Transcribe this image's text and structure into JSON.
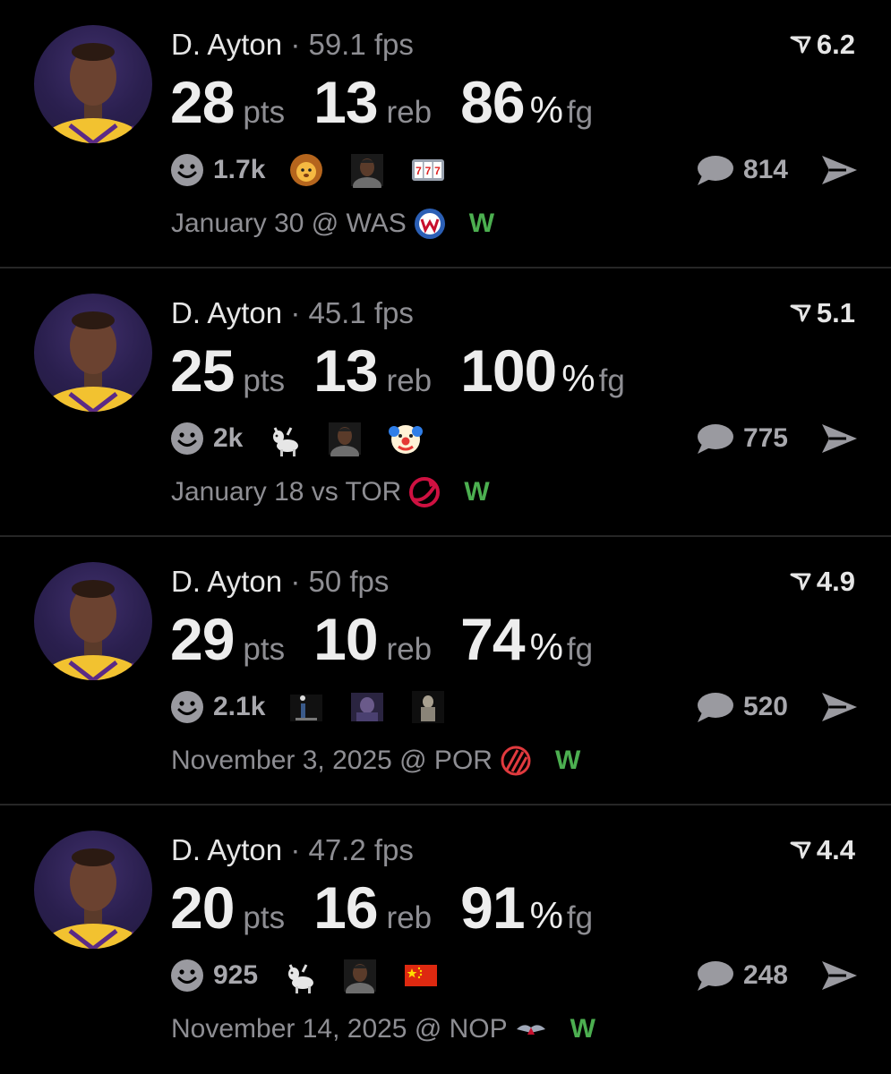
{
  "colors": {
    "background": "#000000",
    "win": "#4caf50",
    "muted": "#8e8e93",
    "text": "#ededed"
  },
  "posts": [
    {
      "player": "D. Ayton",
      "fps_text": "· 59.1 fps",
      "score": "6.2",
      "pts": "28",
      "pts_label": "pts",
      "reb": "13",
      "reb_label": "reb",
      "fg": "86",
      "fg_pct": "%",
      "fg_label": "fg",
      "reaction_count": "1.7k",
      "reaction_icons": [
        "lion-emoji-icon",
        "person-reaction-icon",
        "slot-777-icon"
      ],
      "comment_count": "814",
      "date_text": "January 30 @ WAS",
      "team_logo": "wizards-logo-icon",
      "result": "W"
    },
    {
      "player": "D. Ayton",
      "fps_text": "· 45.1 fps",
      "score": "5.1",
      "pts": "25",
      "pts_label": "pts",
      "reb": "13",
      "reb_label": "reb",
      "fg": "100",
      "fg_pct": "%",
      "fg_label": "fg",
      "reaction_count": "2k",
      "reaction_icons": [
        "goat-emoji-icon",
        "person-reaction-icon",
        "clown-emoji-icon"
      ],
      "comment_count": "775",
      "date_text": "January 18 vs TOR",
      "team_logo": "raptors-logo-icon",
      "result": "W"
    },
    {
      "player": "D. Ayton",
      "fps_text": "· 50 fps",
      "score": "4.9",
      "pts": "29",
      "pts_label": "pts",
      "reb": "10",
      "reb_label": "reb",
      "fg": "74",
      "fg_pct": "%",
      "fg_label": "fg",
      "reaction_count": "2.1k",
      "reaction_icons": [
        "photo-reaction-icon",
        "photo-reaction-icon",
        "photo-reaction-icon"
      ],
      "comment_count": "520",
      "date_text": "November 3, 2025 @ POR",
      "team_logo": "blazers-logo-icon",
      "result": "W"
    },
    {
      "player": "D. Ayton",
      "fps_text": "· 47.2 fps",
      "score": "4.4",
      "pts": "20",
      "pts_label": "pts",
      "reb": "16",
      "reb_label": "reb",
      "fg": "91",
      "fg_pct": "%",
      "fg_label": "fg",
      "reaction_count": "925",
      "reaction_icons": [
        "goat-emoji-icon",
        "person-reaction-icon",
        "china-flag-icon"
      ],
      "comment_count": "248",
      "date_text": "November 14, 2025 @ NOP",
      "team_logo": "pelicans-logo-icon",
      "result": "W"
    }
  ]
}
